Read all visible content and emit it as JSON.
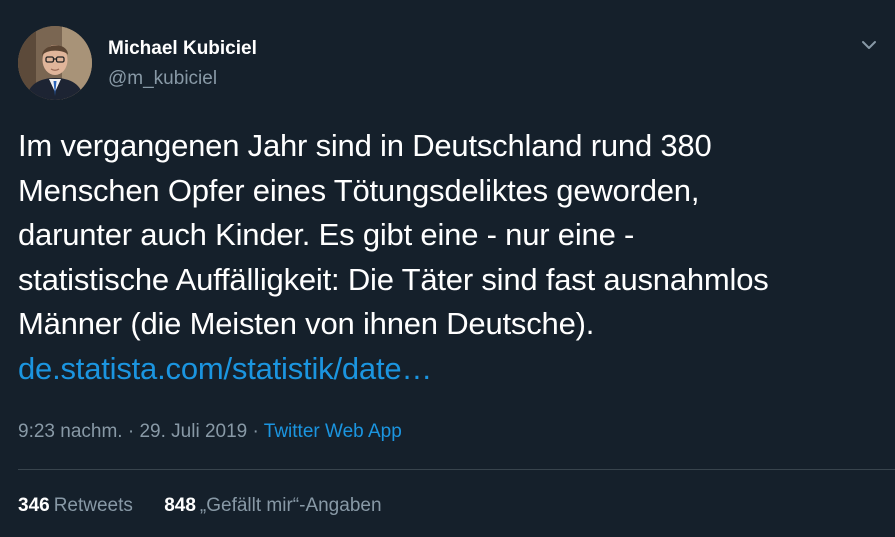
{
  "author": {
    "name": "Michael Kubiciel",
    "handle": "@m_kubiciel"
  },
  "icons": {
    "menu": "chevron-down-icon",
    "avatar": "profile-photo"
  },
  "tweet": {
    "lines": [
      "Im vergangenen Jahr sind in Deutschland rund 380",
      "Menschen Opfer eines Tötungsdeliktes geworden,",
      "darunter auch Kinder. Es gibt eine - nur eine -",
      "statistische Auffälligkeit: Die Täter sind fast ausnahmlos",
      "Männer (die Meisten von ihnen Deutsche)."
    ],
    "link": "de.statista.com/statistik/date…"
  },
  "meta": {
    "time": "9:23 nachm.",
    "separator1": " · ",
    "date": "29. Juli 2019",
    "separator2": " · ",
    "source": "Twitter Web App"
  },
  "stats": {
    "retweets_count": "346",
    "retweets_label": "Retweets",
    "likes_count": "848",
    "likes_label": "„Gefällt mir“-Angaben"
  },
  "colors": {
    "background": "#15202b",
    "text": "#ffffff",
    "secondary": "#8899a6",
    "link": "#1b95e0",
    "divider": "#38444d"
  }
}
